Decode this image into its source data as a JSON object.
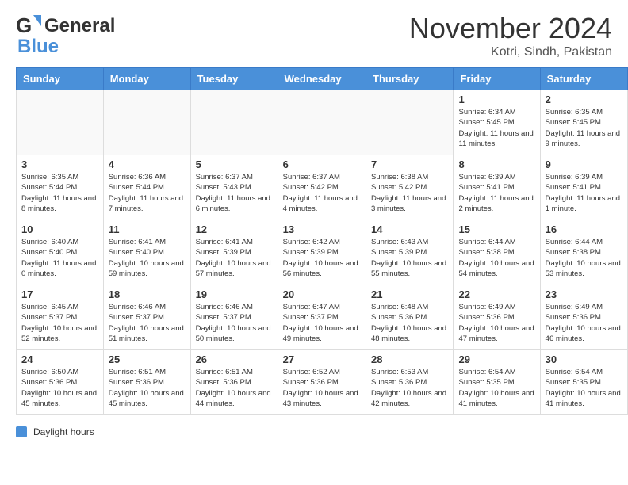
{
  "header": {
    "logo_general": "General",
    "logo_blue": "Blue",
    "month_title": "November 2024",
    "location": "Kotri, Sindh, Pakistan"
  },
  "calendar": {
    "days_of_week": [
      "Sunday",
      "Monday",
      "Tuesday",
      "Wednesday",
      "Thursday",
      "Friday",
      "Saturday"
    ],
    "weeks": [
      [
        {
          "day": "",
          "info": ""
        },
        {
          "day": "",
          "info": ""
        },
        {
          "day": "",
          "info": ""
        },
        {
          "day": "",
          "info": ""
        },
        {
          "day": "",
          "info": ""
        },
        {
          "day": "1",
          "info": "Sunrise: 6:34 AM\nSunset: 5:45 PM\nDaylight: 11 hours and 11 minutes."
        },
        {
          "day": "2",
          "info": "Sunrise: 6:35 AM\nSunset: 5:45 PM\nDaylight: 11 hours and 9 minutes."
        }
      ],
      [
        {
          "day": "3",
          "info": "Sunrise: 6:35 AM\nSunset: 5:44 PM\nDaylight: 11 hours and 8 minutes."
        },
        {
          "day": "4",
          "info": "Sunrise: 6:36 AM\nSunset: 5:44 PM\nDaylight: 11 hours and 7 minutes."
        },
        {
          "day": "5",
          "info": "Sunrise: 6:37 AM\nSunset: 5:43 PM\nDaylight: 11 hours and 6 minutes."
        },
        {
          "day": "6",
          "info": "Sunrise: 6:37 AM\nSunset: 5:42 PM\nDaylight: 11 hours and 4 minutes."
        },
        {
          "day": "7",
          "info": "Sunrise: 6:38 AM\nSunset: 5:42 PM\nDaylight: 11 hours and 3 minutes."
        },
        {
          "day": "8",
          "info": "Sunrise: 6:39 AM\nSunset: 5:41 PM\nDaylight: 11 hours and 2 minutes."
        },
        {
          "day": "9",
          "info": "Sunrise: 6:39 AM\nSunset: 5:41 PM\nDaylight: 11 hours and 1 minute."
        }
      ],
      [
        {
          "day": "10",
          "info": "Sunrise: 6:40 AM\nSunset: 5:40 PM\nDaylight: 11 hours and 0 minutes."
        },
        {
          "day": "11",
          "info": "Sunrise: 6:41 AM\nSunset: 5:40 PM\nDaylight: 10 hours and 59 minutes."
        },
        {
          "day": "12",
          "info": "Sunrise: 6:41 AM\nSunset: 5:39 PM\nDaylight: 10 hours and 57 minutes."
        },
        {
          "day": "13",
          "info": "Sunrise: 6:42 AM\nSunset: 5:39 PM\nDaylight: 10 hours and 56 minutes."
        },
        {
          "day": "14",
          "info": "Sunrise: 6:43 AM\nSunset: 5:39 PM\nDaylight: 10 hours and 55 minutes."
        },
        {
          "day": "15",
          "info": "Sunrise: 6:44 AM\nSunset: 5:38 PM\nDaylight: 10 hours and 54 minutes."
        },
        {
          "day": "16",
          "info": "Sunrise: 6:44 AM\nSunset: 5:38 PM\nDaylight: 10 hours and 53 minutes."
        }
      ],
      [
        {
          "day": "17",
          "info": "Sunrise: 6:45 AM\nSunset: 5:37 PM\nDaylight: 10 hours and 52 minutes."
        },
        {
          "day": "18",
          "info": "Sunrise: 6:46 AM\nSunset: 5:37 PM\nDaylight: 10 hours and 51 minutes."
        },
        {
          "day": "19",
          "info": "Sunrise: 6:46 AM\nSunset: 5:37 PM\nDaylight: 10 hours and 50 minutes."
        },
        {
          "day": "20",
          "info": "Sunrise: 6:47 AM\nSunset: 5:37 PM\nDaylight: 10 hours and 49 minutes."
        },
        {
          "day": "21",
          "info": "Sunrise: 6:48 AM\nSunset: 5:36 PM\nDaylight: 10 hours and 48 minutes."
        },
        {
          "day": "22",
          "info": "Sunrise: 6:49 AM\nSunset: 5:36 PM\nDaylight: 10 hours and 47 minutes."
        },
        {
          "day": "23",
          "info": "Sunrise: 6:49 AM\nSunset: 5:36 PM\nDaylight: 10 hours and 46 minutes."
        }
      ],
      [
        {
          "day": "24",
          "info": "Sunrise: 6:50 AM\nSunset: 5:36 PM\nDaylight: 10 hours and 45 minutes."
        },
        {
          "day": "25",
          "info": "Sunrise: 6:51 AM\nSunset: 5:36 PM\nDaylight: 10 hours and 45 minutes."
        },
        {
          "day": "26",
          "info": "Sunrise: 6:51 AM\nSunset: 5:36 PM\nDaylight: 10 hours and 44 minutes."
        },
        {
          "day": "27",
          "info": "Sunrise: 6:52 AM\nSunset: 5:36 PM\nDaylight: 10 hours and 43 minutes."
        },
        {
          "day": "28",
          "info": "Sunrise: 6:53 AM\nSunset: 5:36 PM\nDaylight: 10 hours and 42 minutes."
        },
        {
          "day": "29",
          "info": "Sunrise: 6:54 AM\nSunset: 5:35 PM\nDaylight: 10 hours and 41 minutes."
        },
        {
          "day": "30",
          "info": "Sunrise: 6:54 AM\nSunset: 5:35 PM\nDaylight: 10 hours and 41 minutes."
        }
      ]
    ]
  },
  "footer": {
    "daylight_label": "Daylight hours"
  }
}
